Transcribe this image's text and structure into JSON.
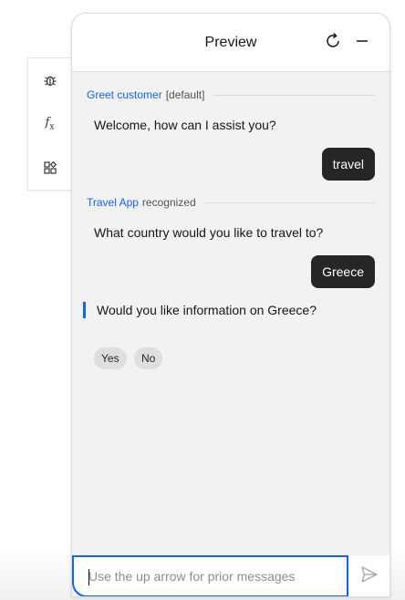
{
  "toolbar": {
    "items": [
      {
        "icon": "bug-icon"
      },
      {
        "icon": "function-icon",
        "label": "f",
        "sub": "x"
      },
      {
        "icon": "widgets-icon"
      }
    ]
  },
  "panel": {
    "title": "Preview",
    "refresh_icon": "refresh-icon",
    "minimize_icon": "minimize-icon"
  },
  "conversation": {
    "step1": {
      "link": "Greet customer",
      "tag": "[default]"
    },
    "bot1": "Welcome, how can I assist you?",
    "user1": "travel",
    "step2": {
      "link": "Travel App",
      "tag": "recognized"
    },
    "bot2": "What country would you like to travel to?",
    "user2": "Greece",
    "bot3": "Would you like information on Greece?",
    "options": [
      "Yes",
      "No"
    ]
  },
  "input": {
    "placeholder": "Use the up arrow for prior messages",
    "value": "",
    "send_icon": "send-icon"
  },
  "colors": {
    "accent": "#0f62fe",
    "user_bubble": "#262626",
    "panel_bg": "#f2f2f2"
  }
}
